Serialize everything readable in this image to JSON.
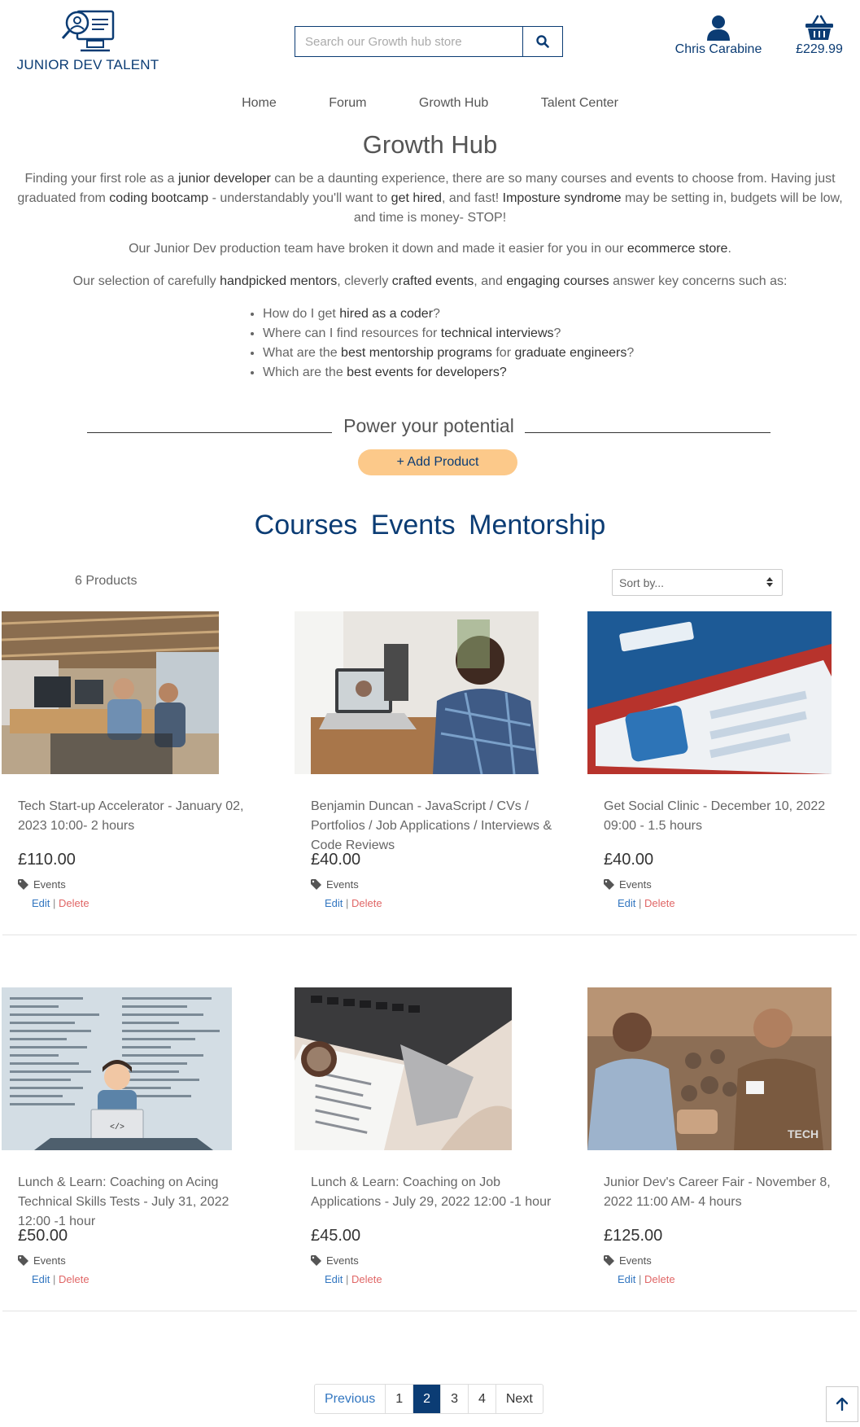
{
  "header": {
    "logo_text": "JUNIOR DEV TALENT",
    "search_placeholder": "Search our Growth hub store",
    "account_name": "Chris Carabine",
    "basket_total": "£229.99"
  },
  "nav": {
    "items": [
      {
        "label": "Home"
      },
      {
        "label": "Forum"
      },
      {
        "label": "Growth Hub"
      },
      {
        "label": "Talent Center"
      }
    ]
  },
  "intro": {
    "title": "Growth Hub",
    "p1": [
      "Finding your first role as a ",
      "junior developer",
      " can be a daunting experience, there are so many courses and events to choose from. Having just graduated from ",
      "coding bootcamp",
      " - understandably you'll want to ",
      "get hired",
      ", and fast! ",
      "Imposture syndrome",
      " may be setting in, budgets will be low, and time is money- STOP!"
    ],
    "p2": [
      "Our Junior Dev production team have broken it down and made it easier for you in our ",
      "ecommerce store",
      "."
    ],
    "p3": [
      "Our selection of carefully ",
      "handpicked mentors",
      ", cleverly ",
      "crafted events",
      ", and ",
      "engaging courses",
      " answer key concerns such as:"
    ],
    "bullets": [
      [
        "How do I get ",
        "hired as a coder",
        "?"
      ],
      [
        "Where can I find resources for ",
        "technical interviews",
        "?"
      ],
      [
        "What are the ",
        "best mentorship programs",
        " for ",
        "graduate engineers",
        "?"
      ],
      [
        "Which are the ",
        "best events for developers?",
        ""
      ]
    ]
  },
  "section": {
    "divider_title": "Power your potential",
    "add_product": "+ Add Product",
    "categories": [
      "Courses",
      "Events",
      "Mentorship"
    ],
    "product_count": "6 Products",
    "sort_label": "Sort by..."
  },
  "products": [
    {
      "title": "Tech Start-up Accelerator - January 02, 2023 10:00- 2 hours",
      "price": "£110.00",
      "category": "Events",
      "edit": "Edit",
      "sep": "|",
      "delete": "Delete",
      "image": "office-coworking-photo"
    },
    {
      "title": "Benjamin Duncan - JavaScript / CVs / Portfolios / Job Applications / Interviews & Code Reviews",
      "price": "£40.00",
      "category": "Events",
      "edit": "Edit",
      "sep": "|",
      "delete": "Delete",
      "image": "video-call-photo"
    },
    {
      "title": "Get Social Clinic - December 10, 2022 09:00 - 1.5 hours",
      "price": "£40.00",
      "category": "Events",
      "edit": "Edit",
      "sep": "|",
      "delete": "Delete",
      "image": "linkedin-tablet-photo"
    },
    {
      "title": "Lunch & Learn: Coaching on Acing Technical Skills Tests - July 31, 2022 12:00 -1 hour",
      "price": "£50.00",
      "category": "Events",
      "edit": "Edit",
      "sep": "|",
      "delete": "Delete",
      "image": "coder-illustration"
    },
    {
      "title": "Lunch & Learn: Coaching on Job Applications - July 29, 2022 12:00 -1 hour",
      "price": "£45.00",
      "category": "Events",
      "edit": "Edit",
      "sep": "|",
      "delete": "Delete",
      "image": "laptop-resume-photo"
    },
    {
      "title": "Junior Dev's Career Fair - November 8, 2022 11:00 AM- 4 hours",
      "price": "£125.00",
      "category": "Events",
      "edit": "Edit",
      "sep": "|",
      "delete": "Delete",
      "image": "career-fair-photo"
    }
  ],
  "pagination": {
    "previous": "Previous",
    "pages": [
      "1",
      "2",
      "3",
      "4"
    ],
    "current": "2",
    "next": "Next"
  },
  "colors": {
    "brand": "#0b3c74",
    "accent": "#fcc98a",
    "link": "#3276c0",
    "danger": "#e06666"
  }
}
